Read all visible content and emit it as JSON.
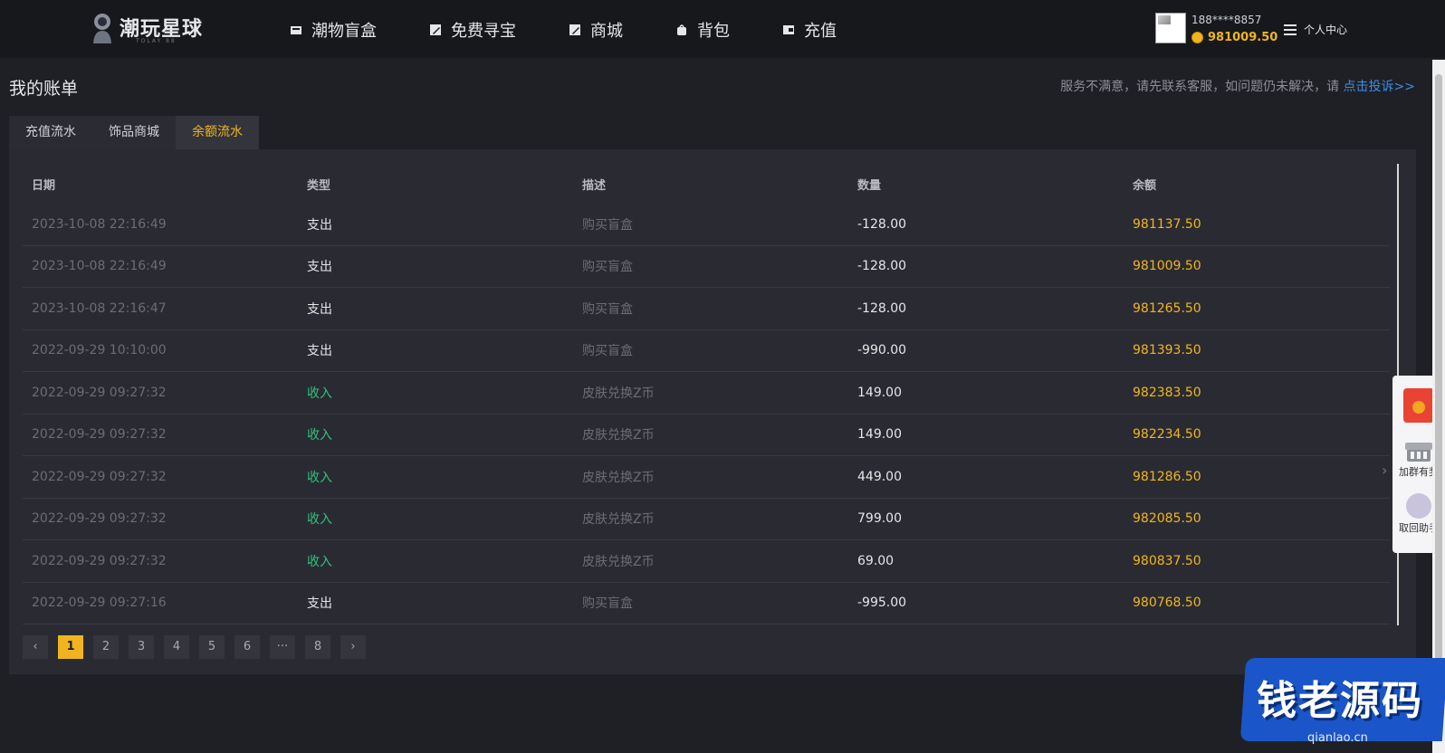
{
  "header": {
    "logo_text": "潮玩星球",
    "logo_sub": "TOLAY 88",
    "nav": [
      {
        "label": "潮物盲盒",
        "icon": "box-icon"
      },
      {
        "label": "免费寻宝",
        "icon": "edit-icon"
      },
      {
        "label": "商城",
        "icon": "edit-icon"
      },
      {
        "label": "背包",
        "icon": "bag-icon"
      },
      {
        "label": "充值",
        "icon": "wallet-icon"
      }
    ],
    "user": {
      "phone": "188****8857",
      "balance": "981009.50",
      "personal_center": "个人中心"
    }
  },
  "page": {
    "title": "我的账单",
    "complaint_text": "服务不满意，请先联系客服，如问题仍未解决，请",
    "complaint_link": "点击投诉>>"
  },
  "tabs": [
    {
      "label": "充值流水",
      "active": false
    },
    {
      "label": "饰品商城",
      "active": false
    },
    {
      "label": "余额流水",
      "active": true
    }
  ],
  "table": {
    "headers": [
      "日期",
      "类型",
      "描述",
      "数量",
      "余额"
    ],
    "rows": [
      {
        "date": "2023-10-08 22:16:49",
        "type": "支出",
        "desc": "购买盲盒",
        "amount": "-128.00",
        "balance": "981137.50"
      },
      {
        "date": "2023-10-08 22:16:49",
        "type": "支出",
        "desc": "购买盲盒",
        "amount": "-128.00",
        "balance": "981009.50"
      },
      {
        "date": "2023-10-08 22:16:47",
        "type": "支出",
        "desc": "购买盲盒",
        "amount": "-128.00",
        "balance": "981265.50"
      },
      {
        "date": "2022-09-29 10:10:00",
        "type": "支出",
        "desc": "购买盲盒",
        "amount": "-990.00",
        "balance": "981393.50"
      },
      {
        "date": "2022-09-29 09:27:32",
        "type": "收入",
        "desc": "皮肤兑换Z币",
        "amount": "149.00",
        "balance": "982383.50"
      },
      {
        "date": "2022-09-29 09:27:32",
        "type": "收入",
        "desc": "皮肤兑换Z币",
        "amount": "149.00",
        "balance": "982234.50"
      },
      {
        "date": "2022-09-29 09:27:32",
        "type": "收入",
        "desc": "皮肤兑换Z币",
        "amount": "449.00",
        "balance": "981286.50"
      },
      {
        "date": "2022-09-29 09:27:32",
        "type": "收入",
        "desc": "皮肤兑换Z币",
        "amount": "799.00",
        "balance": "982085.50"
      },
      {
        "date": "2022-09-29 09:27:32",
        "type": "收入",
        "desc": "皮肤兑换Z币",
        "amount": "69.00",
        "balance": "980837.50"
      },
      {
        "date": "2022-09-29 09:27:16",
        "type": "支出",
        "desc": "购买盲盒",
        "amount": "-995.00",
        "balance": "980768.50"
      }
    ]
  },
  "pagination": {
    "prev": "‹",
    "pages": [
      "1",
      "2",
      "3",
      "4",
      "5",
      "6",
      "···",
      "8"
    ],
    "current": "1",
    "next": "›"
  },
  "side_widget": {
    "items": [
      {
        "label": "",
        "icon": "red-packet-icon"
      },
      {
        "label": "加群有奖",
        "icon": "shop-icon"
      },
      {
        "label": "取回助手",
        "icon": "share-icon"
      }
    ]
  },
  "watermark": {
    "text": "钱老源码",
    "url": "qianlao.cn"
  },
  "colors": {
    "accent": "#f0b51e",
    "income": "#2fc27a",
    "link": "#3b8de8",
    "background": "#1f2026",
    "panel": "#2a2b32"
  }
}
